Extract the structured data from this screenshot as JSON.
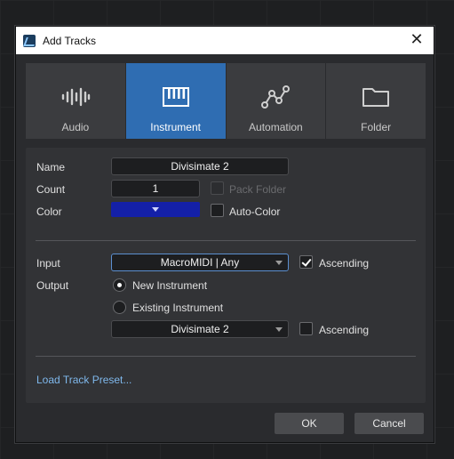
{
  "dialog": {
    "title": "Add Tracks",
    "close_glyph": "✕"
  },
  "tabs": [
    {
      "label": "Audio",
      "icon": "audio-waveform-icon",
      "active": false
    },
    {
      "label": "Instrument",
      "icon": "keyboard-icon",
      "active": true
    },
    {
      "label": "Automation",
      "icon": "automation-curve-icon",
      "active": false
    },
    {
      "label": "Folder",
      "icon": "folder-icon",
      "active": false
    }
  ],
  "form": {
    "name_label": "Name",
    "name_value": "Divisimate 2",
    "count_label": "Count",
    "count_value": "1",
    "pack_folder_label": "Pack Folder",
    "pack_folder_checked": false,
    "pack_folder_disabled": true,
    "color_label": "Color",
    "color_value": "#1420a8",
    "auto_color_label": "Auto-Color",
    "auto_color_checked": false,
    "input_label": "Input",
    "input_value": "MacroMIDI | Any",
    "input_ascending_label": "Ascending",
    "input_ascending_checked": true,
    "output_label": "Output",
    "new_instrument_label": "New Instrument",
    "new_instrument_selected": true,
    "existing_instrument_label": "Existing Instrument",
    "existing_instrument_selected": false,
    "existing_instrument_value": "Divisimate 2",
    "output_ascending_label": "Ascending",
    "output_ascending_checked": false,
    "load_preset_label": "Load Track Preset..."
  },
  "buttons": {
    "ok_label": "OK",
    "cancel_label": "Cancel"
  },
  "colors": {
    "accent_tab": "#2f6db2",
    "link": "#7fb8ec"
  }
}
